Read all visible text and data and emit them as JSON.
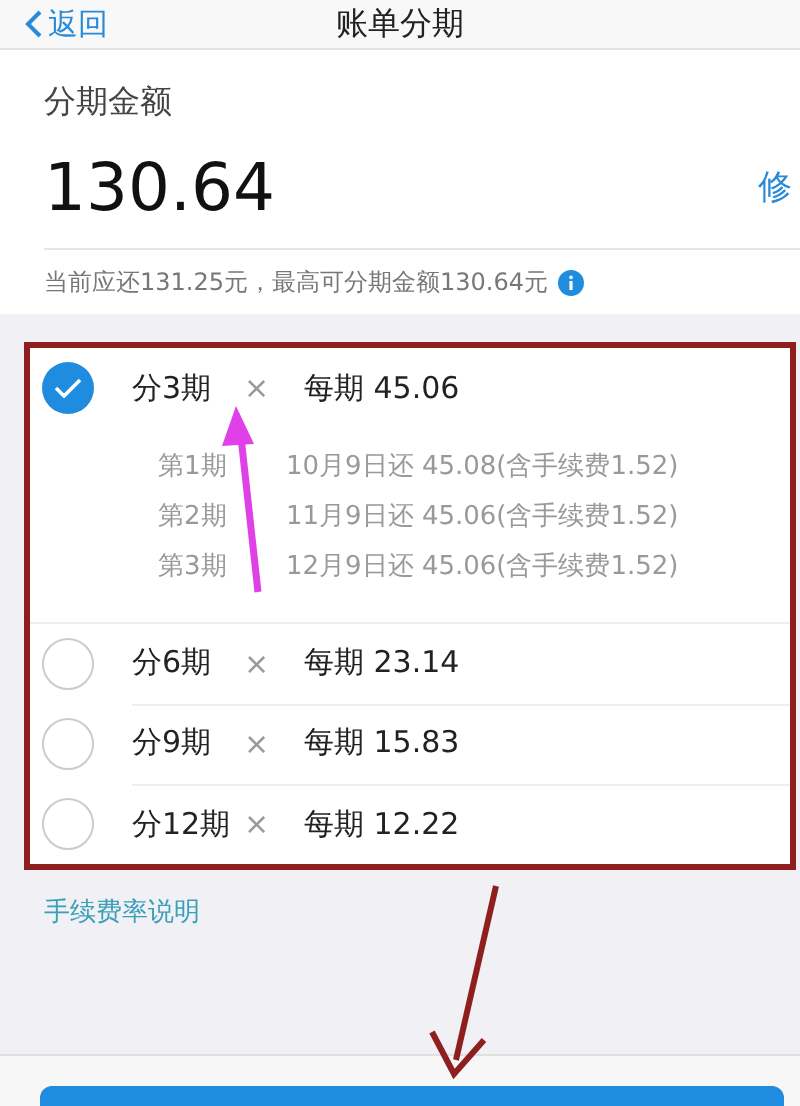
{
  "header": {
    "back": "返回",
    "title": "账单分期"
  },
  "amount": {
    "label": "分期金额",
    "value": "130.64",
    "edit": "修",
    "note": "当前应还131.25元，最高可分期金额130.64元"
  },
  "plans": [
    {
      "term": "分3期",
      "times": "×",
      "per": "每期 45.06",
      "selected": true,
      "schedule": [
        {
          "period": "第1期",
          "detail": "10月9日还 45.08(含手续费1.52)"
        },
        {
          "period": "第2期",
          "detail": "11月9日还 45.06(含手续费1.52)"
        },
        {
          "period": "第3期",
          "detail": "12月9日还 45.06(含手续费1.52)"
        }
      ]
    },
    {
      "term": "分6期",
      "times": "×",
      "per": "每期 23.14",
      "selected": false
    },
    {
      "term": "分9期",
      "times": "×",
      "per": "每期 15.83",
      "selected": false
    },
    {
      "term": "分12期",
      "times": "×",
      "per": "每期 12.22",
      "selected": false
    }
  ],
  "fee_link": "手续费率说明"
}
